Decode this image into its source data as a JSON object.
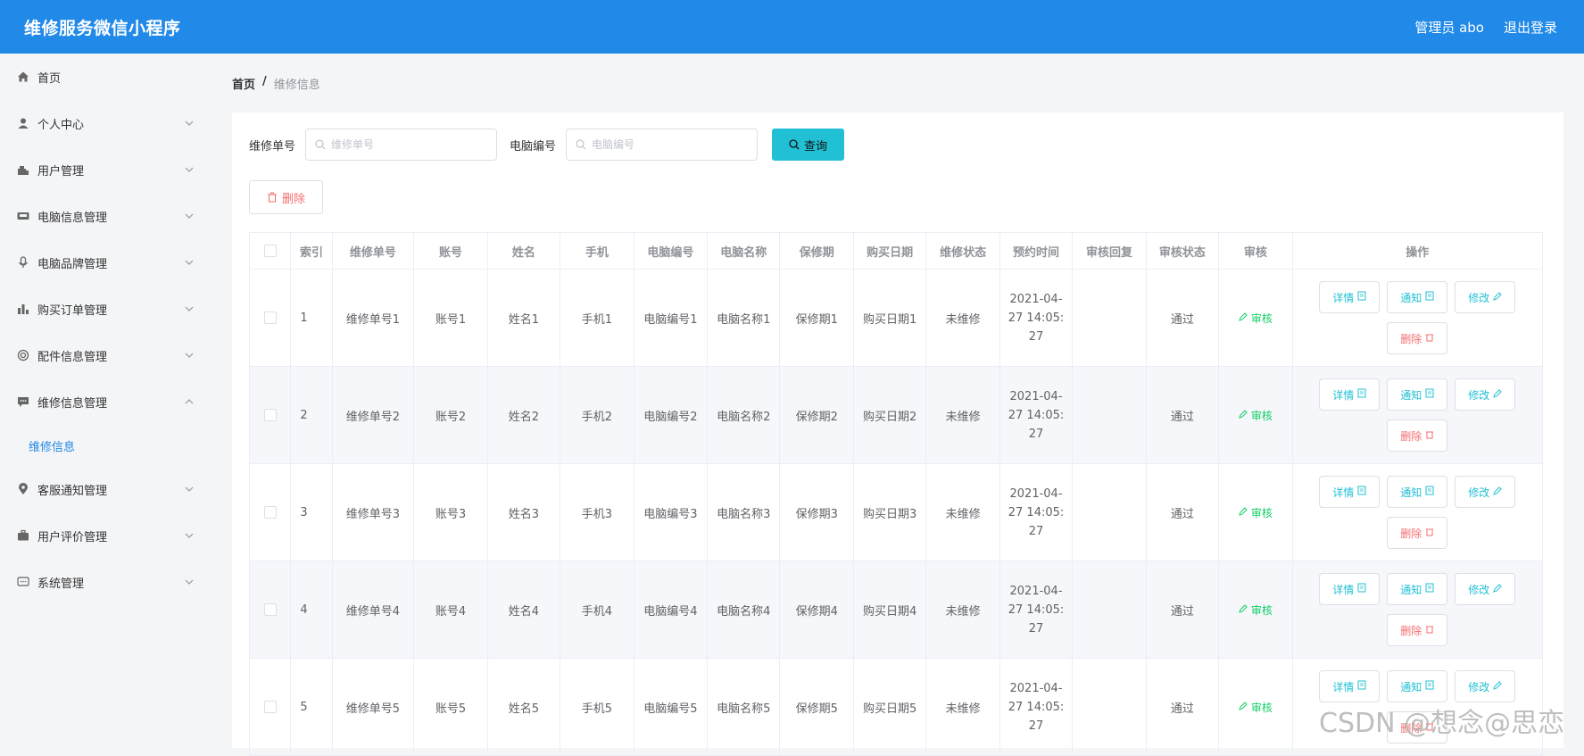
{
  "header": {
    "title": "维修服务微信小程序",
    "admin": "管理员 abo",
    "logout": "退出登录"
  },
  "sidebar": {
    "items": [
      {
        "label": "首页",
        "icon": "home-icon",
        "has_chevron": false
      },
      {
        "label": "个人中心",
        "icon": "user-icon",
        "has_chevron": true
      },
      {
        "label": "用户管理",
        "icon": "user-manage-icon",
        "has_chevron": true
      },
      {
        "label": "电脑信息管理",
        "icon": "computer-icon",
        "has_chevron": true
      },
      {
        "label": "电脑品牌管理",
        "icon": "microphone-icon",
        "has_chevron": true
      },
      {
        "label": "购买订单管理",
        "icon": "bar-chart-icon",
        "has_chevron": true
      },
      {
        "label": "配件信息管理",
        "icon": "lifebuoy-icon",
        "has_chevron": true
      },
      {
        "label": "维修信息管理",
        "icon": "chat-icon",
        "has_chevron": true,
        "expanded": true
      },
      {
        "label": "客服通知管理",
        "icon": "location-icon",
        "has_chevron": true
      },
      {
        "label": "用户评价管理",
        "icon": "suitcase-icon",
        "has_chevron": true
      },
      {
        "label": "系统管理",
        "icon": "message-icon",
        "has_chevron": true
      }
    ],
    "submenu_active": "维修信息"
  },
  "breadcrumb": {
    "home": "首页",
    "sep": "/",
    "current": "维修信息"
  },
  "search": {
    "field1_label": "维修单号",
    "field1_placeholder": "维修单号",
    "field2_label": "电脑编号",
    "field2_placeholder": "电脑编号",
    "query_label": "查询"
  },
  "toolbar": {
    "delete_label": "删除"
  },
  "table": {
    "columns": [
      "索引",
      "维修单号",
      "账号",
      "姓名",
      "手机",
      "电脑编号",
      "电脑名称",
      "保修期",
      "购买日期",
      "维修状态",
      "预约时间",
      "审核回复",
      "审核状态",
      "审核",
      "操作"
    ],
    "rows": [
      {
        "idx": "1",
        "order": "维修单号1",
        "account": "账号1",
        "name": "姓名1",
        "phone": "手机1",
        "pc_no": "电脑编号1",
        "pc_name": "电脑名称1",
        "warranty": "保修期1",
        "buy_date": "购买日期1",
        "repair_status": "未维修",
        "time1": "2021-04-",
        "time2": "27 14:05:",
        "time3": "27",
        "reply": "",
        "audit_status": "通过"
      },
      {
        "idx": "2",
        "order": "维修单号2",
        "account": "账号2",
        "name": "姓名2",
        "phone": "手机2",
        "pc_no": "电脑编号2",
        "pc_name": "电脑名称2",
        "warranty": "保修期2",
        "buy_date": "购买日期2",
        "repair_status": "未维修",
        "time1": "2021-04-",
        "time2": "27 14:05:",
        "time3": "27",
        "reply": "",
        "audit_status": "通过"
      },
      {
        "idx": "3",
        "order": "维修单号3",
        "account": "账号3",
        "name": "姓名3",
        "phone": "手机3",
        "pc_no": "电脑编号3",
        "pc_name": "电脑名称3",
        "warranty": "保修期3",
        "buy_date": "购买日期3",
        "repair_status": "未维修",
        "time1": "2021-04-",
        "time2": "27 14:05:",
        "time3": "27",
        "reply": "",
        "audit_status": "通过"
      },
      {
        "idx": "4",
        "order": "维修单号4",
        "account": "账号4",
        "name": "姓名4",
        "phone": "手机4",
        "pc_no": "电脑编号4",
        "pc_name": "电脑名称4",
        "warranty": "保修期4",
        "buy_date": "购买日期4",
        "repair_status": "未维修",
        "time1": "2021-04-",
        "time2": "27 14:05:",
        "time3": "27",
        "reply": "",
        "audit_status": "通过"
      },
      {
        "idx": "5",
        "order": "维修单号5",
        "account": "账号5",
        "name": "姓名5",
        "phone": "手机5",
        "pc_no": "电脑编号5",
        "pc_name": "电脑名称5",
        "warranty": "保修期5",
        "buy_date": "购买日期5",
        "repair_status": "未维修",
        "time1": "2021-04-",
        "time2": "27 14:05:",
        "time3": "27",
        "reply": "",
        "audit_status": "通过"
      }
    ],
    "audit_label": "审核",
    "ops": {
      "detail": "详情",
      "notify": "通知",
      "edit": "修改",
      "delete": "删除"
    }
  },
  "watermark": "CSDN @想念@思恋",
  "colors": {
    "header_bg": "#2189e8",
    "accent": "#22c0d5",
    "danger": "#f56c6c",
    "success": "#13ce66"
  }
}
